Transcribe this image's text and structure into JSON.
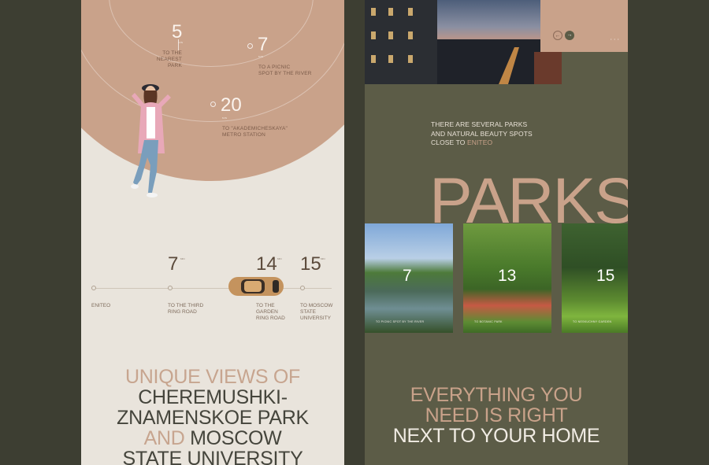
{
  "left_panel": {
    "distances": [
      {
        "value": "5",
        "label_line1": "TO THE NEAREST",
        "label_line2": "PARK",
        "unit": "MIN"
      },
      {
        "value": "7",
        "label_line1": "TO A PICNIC",
        "label_line2": "SPOT BY THE RIVER",
        "unit": "MIN"
      },
      {
        "value": "20",
        "label_line1": "TO \"AKADEMICHESKAYA\"",
        "label_line2": "METRO STATION",
        "unit": "MIN"
      }
    ],
    "route": {
      "start_label": "ENITEO",
      "stops": [
        {
          "value": "7",
          "label_line1": "TO THE THIRD",
          "label_line2": "RING ROAD",
          "label_line3": "",
          "unit": "MIN"
        },
        {
          "value": "14",
          "label_line1": "TO THE",
          "label_line2": "GARDEN",
          "label_line3": "RING ROAD",
          "unit": "MIN"
        },
        {
          "value": "15",
          "label_line1": "TO MOSCOW",
          "label_line2": "STATE",
          "label_line3": "UNIVERSITY",
          "unit": "MIN"
        }
      ]
    },
    "headline": {
      "line1_accent": "UNIQUE VIEWS OF",
      "line2": "CHEREMUSHKI-",
      "line3": "ZNAMENSKOE PARK",
      "line4_accent": "AND",
      "line4_rest": " MOSCOW",
      "line5": "STATE UNIVERSITY"
    }
  },
  "right_panel": {
    "slider": {
      "prev": "←",
      "next": "→",
      "pager": "• • •"
    },
    "intro": {
      "line1": "THERE ARE SEVERAL PARKS",
      "line2": "AND NATURAL BEAUTY SPOTS",
      "line3_prefix": "CLOSE TO ",
      "line3_accent": "ENITEO"
    },
    "big_word": "PARKS",
    "parks": [
      {
        "value": "7",
        "caption": "TO PICNIC SPOT BY THE RIVER"
      },
      {
        "value": "13",
        "caption": "TO BOTANIC PARK"
      },
      {
        "value": "15",
        "caption": "TO NESKUCHNY GARDEN"
      }
    ],
    "bottom_headline": {
      "line1_accent": "EVERYTHING YOU",
      "line2_accent": "NEED IS RIGHT",
      "line3": "NEXT TO YOUR HOME"
    }
  },
  "colors": {
    "page_bg": "#3d3e32",
    "left_bg": "#e9e4dc",
    "accent": "#c9a28a",
    "right_bg": "#5c5c47"
  }
}
